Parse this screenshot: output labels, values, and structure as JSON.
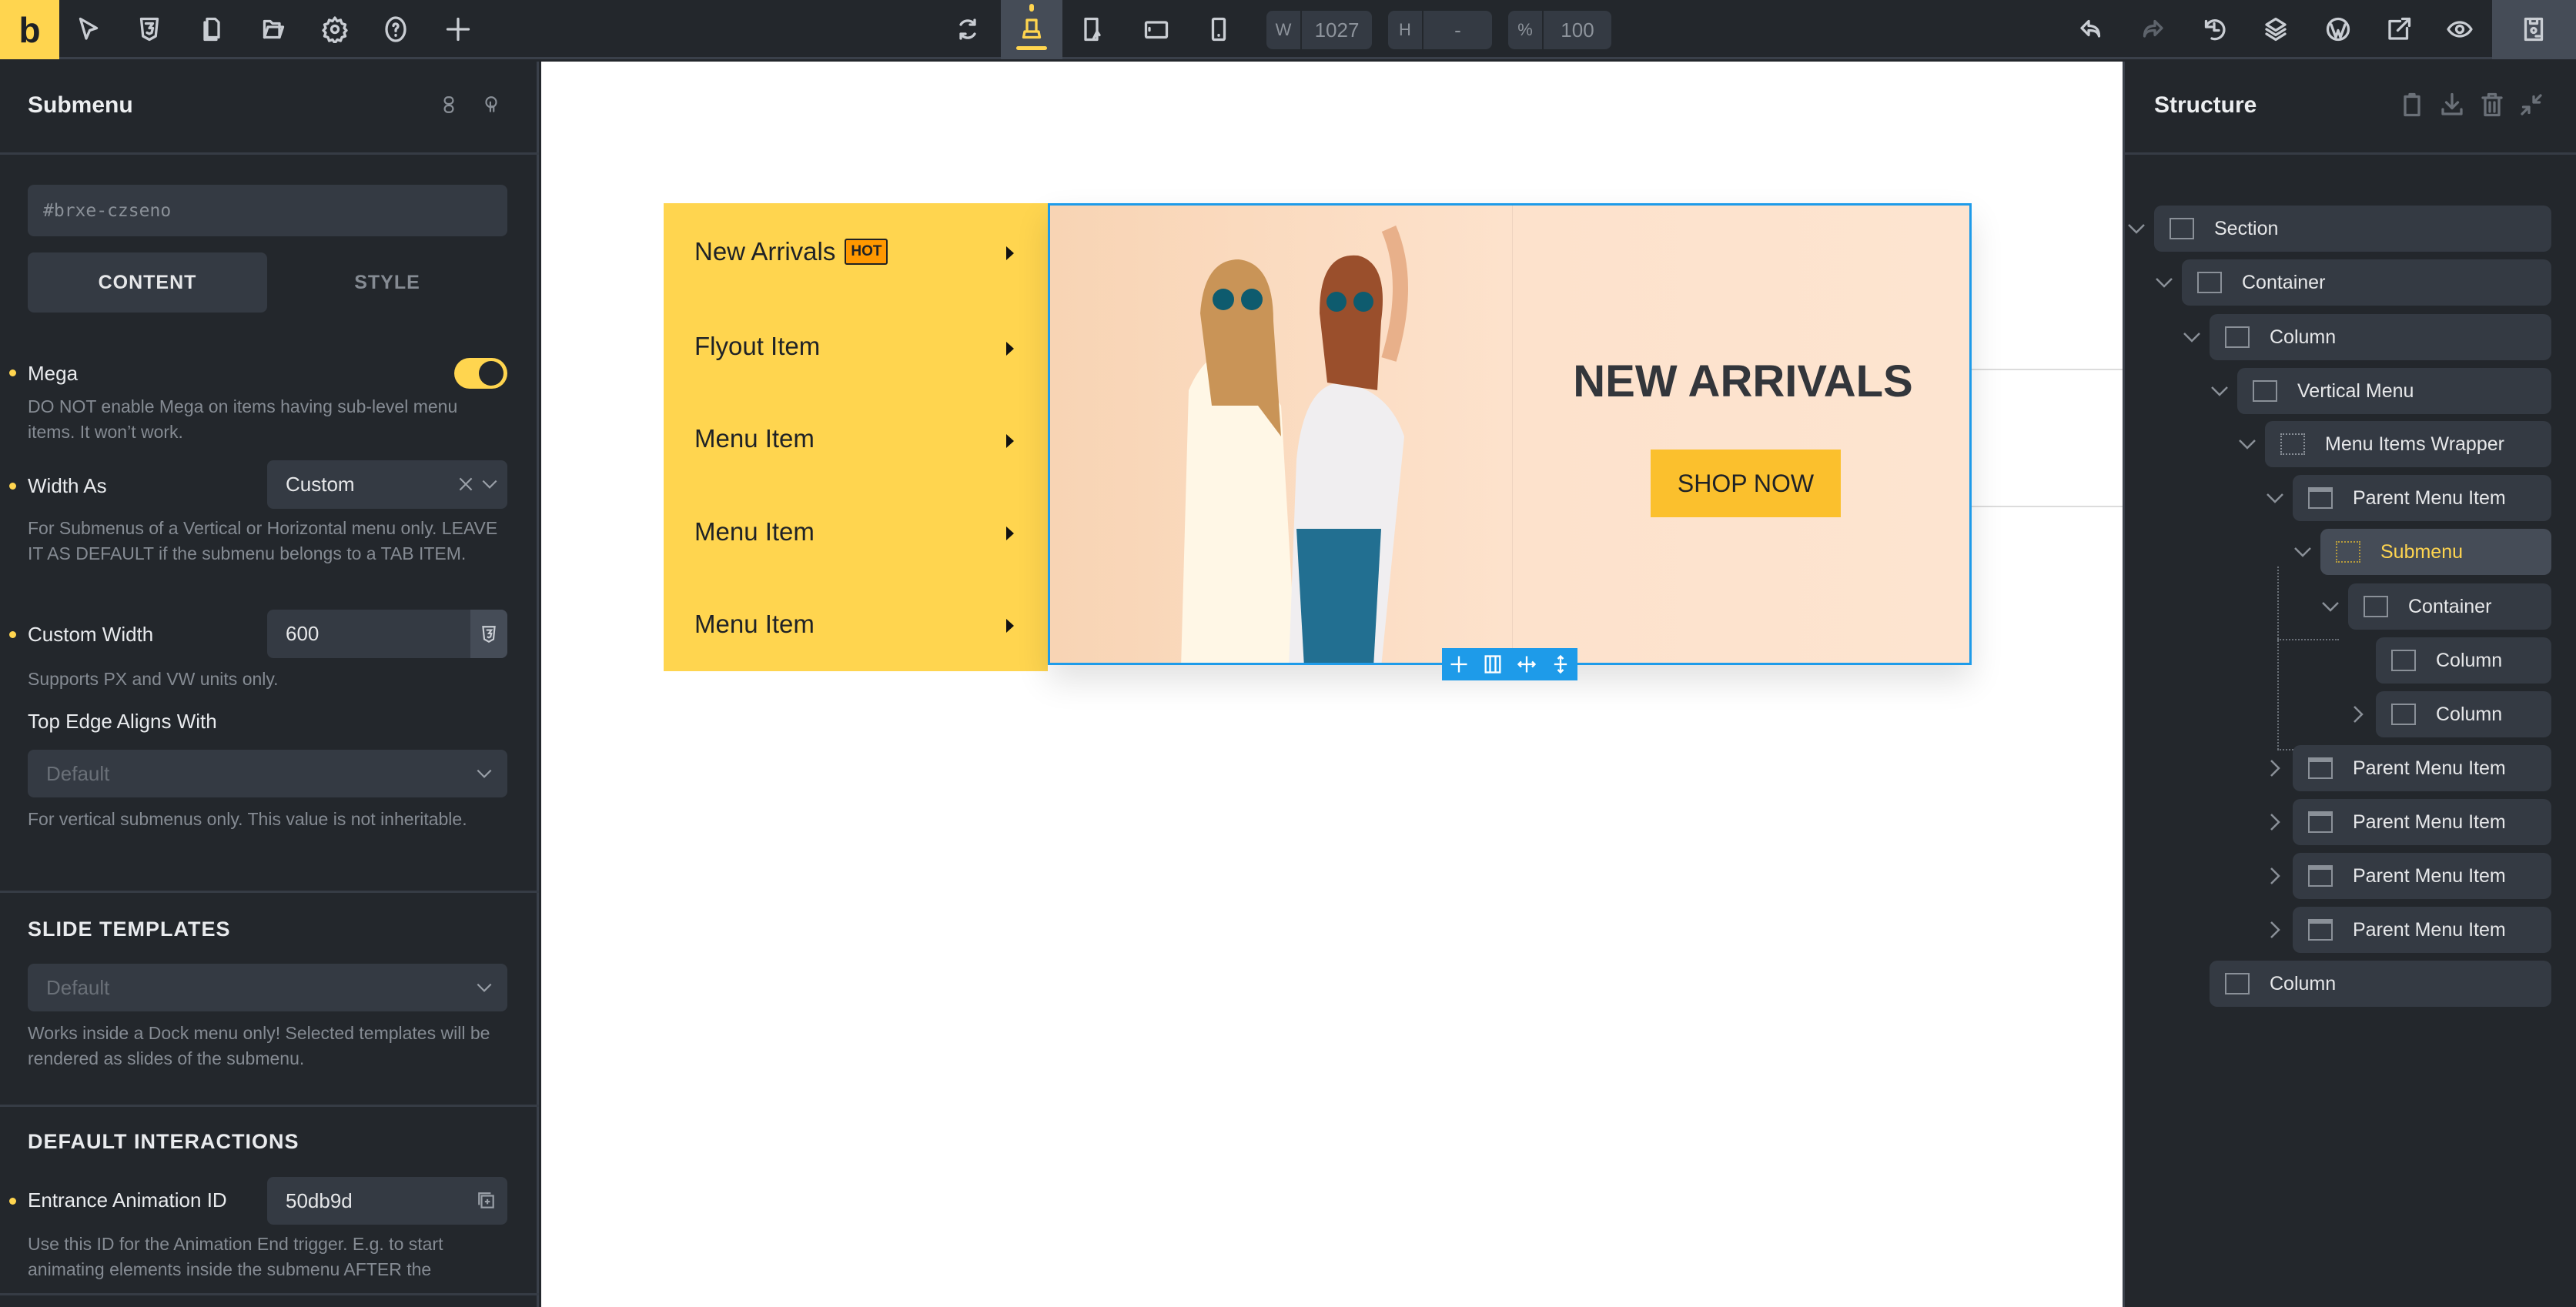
{
  "topbar": {
    "logo": "b",
    "left_icons": [
      "select-cursor-icon",
      "css3-icon",
      "pages-icon",
      "folder-icon",
      "gear-icon",
      "help-icon",
      "plus-icon"
    ],
    "center_icons": [
      "refresh-icon",
      "desktop-icon",
      "tablet-landscape-icon",
      "tablet-icon",
      "mobile-icon"
    ],
    "active_breakpoint": "desktop",
    "width": {
      "key": "W",
      "value": "1027"
    },
    "height": {
      "key": "H",
      "value": "-"
    },
    "zoom": {
      "key": "%",
      "value": "100"
    },
    "right_icons": [
      "undo-icon",
      "redo-icon",
      "history-icon",
      "layers-icon",
      "wordpress-icon",
      "external-link-icon",
      "preview-eye-icon"
    ],
    "save_icon": "save-icon"
  },
  "left": {
    "title": "Submenu",
    "element_id": "#brxe-czseno",
    "tabs": [
      "CONTENT",
      "STYLE"
    ],
    "active_tab": "CONTENT",
    "mega": {
      "label": "Mega",
      "enabled": true,
      "desc": "DO NOT enable Mega on items having sub-level menu items. It won’t work."
    },
    "width_as": {
      "label": "Width As",
      "value": "Custom",
      "desc": "For Submenus of a Vertical or Horizontal menu only. LEAVE IT AS DEFAULT if the submenu belongs to a TAB ITEM."
    },
    "custom_width": {
      "label": "Custom Width",
      "value": "600",
      "desc": "Supports PX and VW units only."
    },
    "top_edge": {
      "label": "Top Edge Aligns With",
      "placeholder": "Default",
      "desc": "For vertical submenus only. This value is not inheritable."
    },
    "slide_templates": {
      "heading": "SLIDE TEMPLATES",
      "placeholder": "Default",
      "desc": "Works inside a Dock menu only! Selected templates will be rendered as slides of the submenu."
    },
    "interactions": {
      "heading": "DEFAULT INTERACTIONS",
      "label": "Entrance Animation ID",
      "value": "50db9d",
      "desc": "Use this ID for the Animation End trigger. E.g. to start animating elements inside the submenu AFTER the"
    }
  },
  "canvas": {
    "menu_items": [
      {
        "label": "New Arrivals",
        "badge": "HOT"
      },
      {
        "label": "Flyout Item"
      },
      {
        "label": "Menu Item"
      },
      {
        "label": "Menu Item"
      },
      {
        "label": "Menu Item"
      }
    ],
    "banner": {
      "heading": "NEW ARRIVALS",
      "button": "SHOP NOW"
    },
    "colors": {
      "menu_bg": "#ffd54f",
      "badge": "#ff9800",
      "button": "#fbc02d",
      "selection": "#1e9be9",
      "banner_bg": "#fde2cc"
    }
  },
  "right": {
    "title": "Structure",
    "header_icons": [
      "clipboard-icon",
      "download-icon",
      "trash-icon",
      "collapse-icon"
    ],
    "tree": [
      {
        "label": "Section",
        "depth": 0,
        "toggle": "open",
        "icon": "section-icon"
      },
      {
        "label": "Container",
        "depth": 1,
        "toggle": "open",
        "icon": "container-icon"
      },
      {
        "label": "Column",
        "depth": 2,
        "toggle": "open",
        "icon": "column-icon"
      },
      {
        "label": "Vertical Menu",
        "depth": 3,
        "toggle": "open",
        "icon": "vertical-menu-icon"
      },
      {
        "label": "Menu Items Wrapper",
        "depth": 4,
        "toggle": "open",
        "icon": "wrapper-icon"
      },
      {
        "label": "Parent Menu Item",
        "depth": 5,
        "toggle": "open",
        "icon": "menu-item-icon"
      },
      {
        "label": "Submenu",
        "depth": 6,
        "toggle": "open",
        "icon": "submenu-icon",
        "active": true
      },
      {
        "label": "Container",
        "depth": 7,
        "toggle": "open",
        "icon": "container-icon"
      },
      {
        "label": "Column",
        "depth": 8,
        "toggle": "none",
        "icon": "column-icon"
      },
      {
        "label": "Column",
        "depth": 8,
        "toggle": "closed",
        "icon": "column-icon"
      },
      {
        "label": "Parent Menu Item",
        "depth": 5,
        "toggle": "closed",
        "icon": "menu-item-icon"
      },
      {
        "label": "Parent Menu Item",
        "depth": 5,
        "toggle": "closed",
        "icon": "menu-item-icon"
      },
      {
        "label": "Parent Menu Item",
        "depth": 5,
        "toggle": "closed",
        "icon": "menu-item-icon"
      },
      {
        "label": "Parent Menu Item",
        "depth": 5,
        "toggle": "closed",
        "icon": "menu-item-icon"
      },
      {
        "label": "Column",
        "depth": 2,
        "toggle": "none",
        "icon": "column-icon"
      }
    ]
  }
}
